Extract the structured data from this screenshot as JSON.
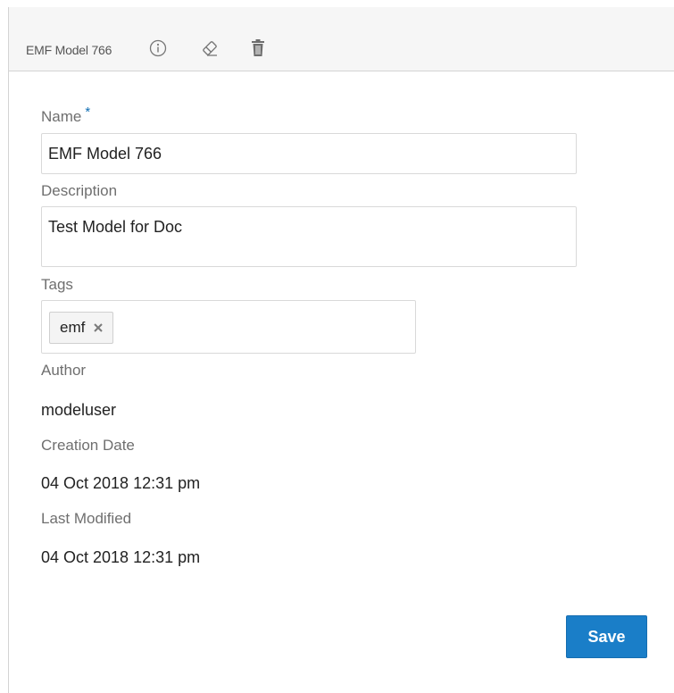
{
  "header": {
    "title": "EMF Model 766",
    "icons": [
      "info-icon",
      "eraser-icon",
      "trash-icon"
    ]
  },
  "form": {
    "name_label": "Name",
    "required_marker": "*",
    "name_value": "EMF Model 766",
    "description_label": "Description",
    "description_value": "Test Model for Doc",
    "tags_label": "Tags",
    "tags": [
      {
        "label": "emf"
      }
    ],
    "author_label": "Author",
    "author_value": "modeluser",
    "creation_date_label": "Creation Date",
    "creation_date_value": "04 Oct 2018 12:31 pm",
    "last_modified_label": "Last Modified",
    "last_modified_value": "04 Oct 2018 12:31 pm"
  },
  "actions": {
    "save_label": "Save"
  },
  "colors": {
    "accent": "#1a7ec8",
    "required": "#0f6db3",
    "header_bg": "#f6f6f6"
  }
}
